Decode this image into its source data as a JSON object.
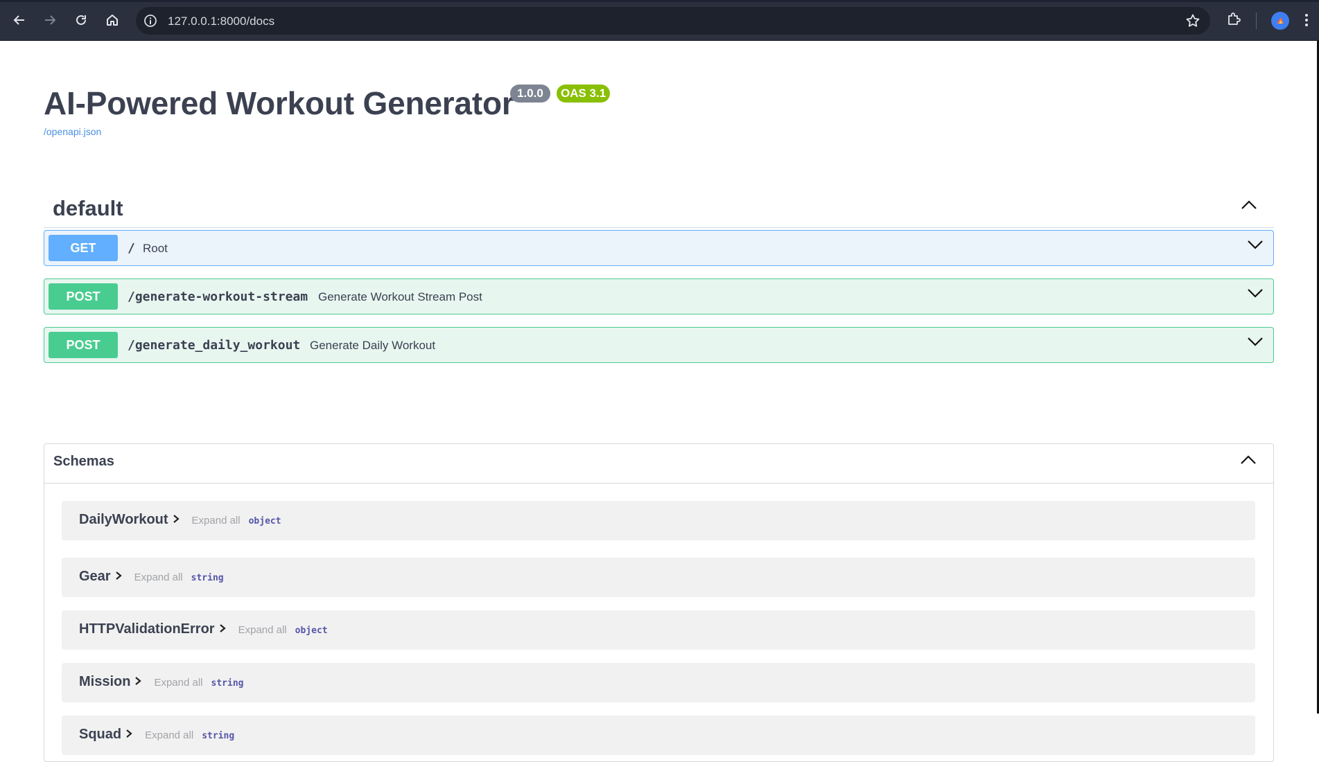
{
  "browser": {
    "url": "127.0.0.1:8000/docs"
  },
  "header": {
    "title": "AI-Powered Workout Generator",
    "version_badge": "1.0.0",
    "oas_badge": "OAS 3.1",
    "spec_link": "/openapi.json"
  },
  "tag": {
    "name": "default"
  },
  "operations": [
    {
      "method": "GET",
      "path": "/",
      "summary": "Root"
    },
    {
      "method": "POST",
      "path": "/generate-workout-stream",
      "summary": "Generate Workout Stream Post"
    },
    {
      "method": "POST",
      "path": "/generate_daily_workout",
      "summary": "Generate Daily Workout"
    }
  ],
  "schemas": {
    "label": "Schemas",
    "expand_label": "Expand all",
    "models": [
      {
        "name": "DailyWorkout",
        "type": "object"
      },
      {
        "name": "Gear",
        "type": "string"
      },
      {
        "name": "HTTPValidationError",
        "type": "object"
      },
      {
        "name": "Mission",
        "type": "string"
      },
      {
        "name": "Squad",
        "type": "string"
      }
    ]
  },
  "colors": {
    "get": "#61affe",
    "post": "#49cc90",
    "oas_badge": "#89bf04",
    "version_badge": "#7d8492"
  }
}
